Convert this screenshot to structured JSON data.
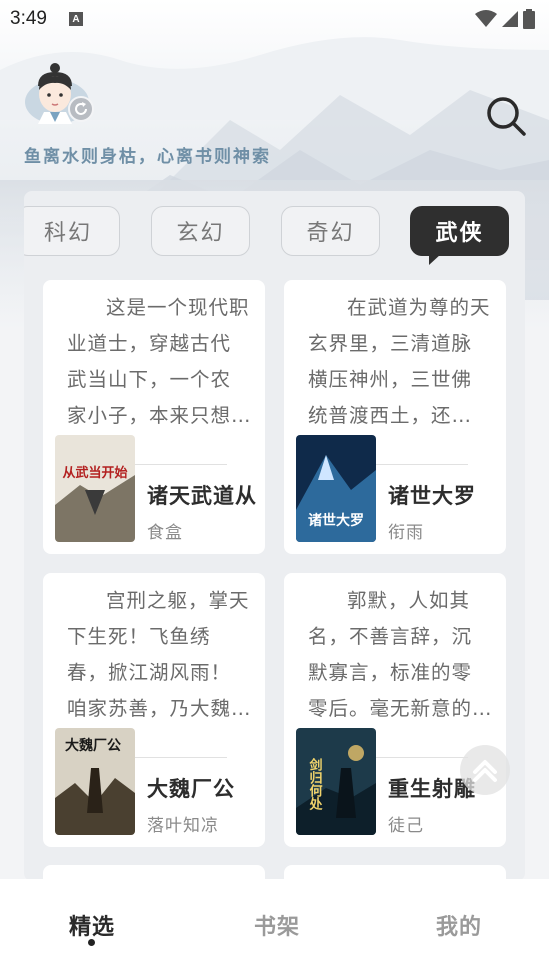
{
  "status_bar": {
    "time": "3:49",
    "notification_glyph": "A",
    "icons": [
      "wifi-icon",
      "signal-icon",
      "battery-icon"
    ]
  },
  "header": {
    "tagline": "鱼离水则身枯，心离书则神索",
    "avatar_icon": "avatar-scholar-icon",
    "sync_icon": "sync-icon",
    "search_icon": "search-icon"
  },
  "tabs": [
    {
      "label": "科幻",
      "active": false
    },
    {
      "label": "玄幻",
      "active": false
    },
    {
      "label": "奇幻",
      "active": false
    },
    {
      "label": "武侠",
      "active": true
    }
  ],
  "books": [
    {
      "description": "这是一个现代职业道士，穿越古代武当山下，一个农家小子，本来只想当个平凡人……",
      "title": "诸天武道从",
      "author": "食盒",
      "cover_text": "从武当开始"
    },
    {
      "description": "在武道为尊的天玄界里，三清道脉横压神州，三世佛统普渡西土，还有……",
      "title": "诸世大罗",
      "author": "衔雨",
      "cover_text": "诸世大罗"
    },
    {
      "description": "宫刑之躯，掌天下生死！飞鱼绣春，掀江湖风雨！咱家苏善，乃大魏厂公……",
      "title": "大魏厂公",
      "author": "落叶知凉",
      "cover_text": "大魏厂公"
    },
    {
      "description": "郭默，人如其名，不善言辞，沉默寡言，标准的零零后。毫无新意的穿越……",
      "title": "重生射雕",
      "author": "徒己",
      "cover_text": "剑归何处"
    }
  ],
  "scroll_top_icon": "chevron-up-icon",
  "bottom_nav": [
    {
      "label": "精选",
      "active": true
    },
    {
      "label": "书架",
      "active": false
    },
    {
      "label": "我的",
      "active": false
    }
  ],
  "colors": {
    "accent_dark": "#2f2f2f",
    "tagline": "#6f8fa6",
    "panel_bg": "#eceef1"
  }
}
